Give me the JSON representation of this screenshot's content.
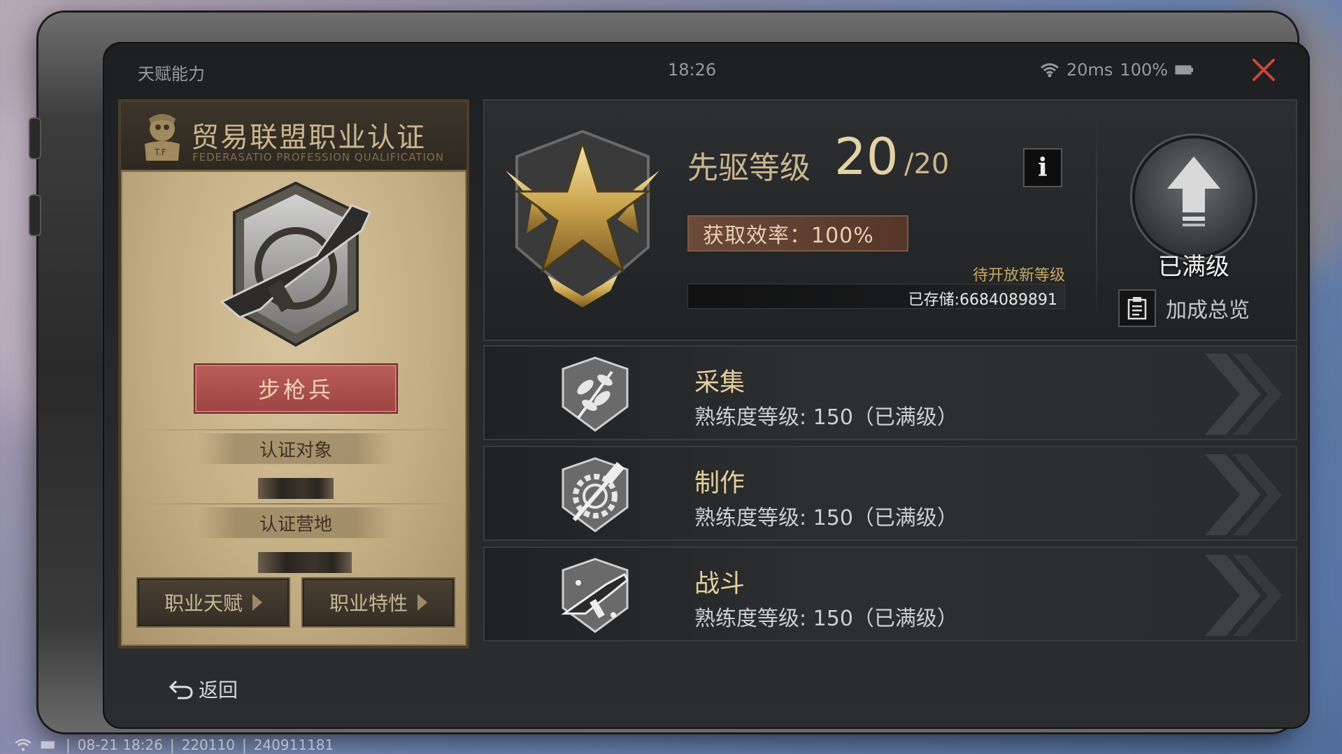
{
  "status_bar": {
    "title": "天赋能力",
    "time": "18:26",
    "ping": "20ms",
    "battery": "100%",
    "icons": {
      "wifi": "wifi-icon",
      "battery": "battery-icon",
      "close": "close-icon"
    },
    "close_color": "#c8473b"
  },
  "certificate": {
    "title": "贸易联盟职业认证",
    "subtitle": "FEDERASATIO PROFESSION QUALIFICATION",
    "role": "步枪兵",
    "target_label": "认证对象",
    "camp_label": "认证营地",
    "buttons": {
      "talent": "职业天赋",
      "trait": "职业特性"
    },
    "emblem_icon": "rifle-emblem-icon"
  },
  "level": {
    "title": "先驱等级",
    "current": "20",
    "max": "/20",
    "efficiency": "获取效率：100%",
    "pending": "待开放新等级",
    "storage": "已存储:6684089891",
    "maxed_label": "已满级",
    "bonus_label": "加成总览",
    "info_label": "i",
    "badge_icon": "gold-star-badge-icon",
    "upgrade_icon": "upgrade-arrow-icon",
    "bonus_icon": "clipboard-icon"
  },
  "skills": [
    {
      "name": "采集",
      "level": "熟练度等级: 150（已满级）",
      "icon": "gathering-leaf-icon"
    },
    {
      "name": "制作",
      "level": "熟练度等级: 150（已满级）",
      "icon": "crafting-gear-hammer-icon"
    },
    {
      "name": "战斗",
      "level": "熟练度等级: 150（已满级）",
      "icon": "combat-smg-icon"
    }
  ],
  "back_label": "返回",
  "footer": {
    "date": "08-21 18:26",
    "code1": "220110",
    "code2": "240911181"
  },
  "colors": {
    "accent_gold": "#c9b68e",
    "role_red": "#b95d5a",
    "efficiency_bg": "#6b4a3a"
  }
}
